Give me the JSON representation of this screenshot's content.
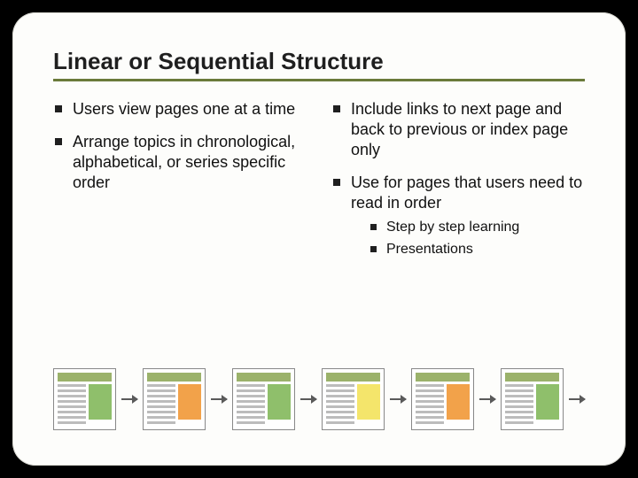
{
  "title": "Linear or Sequential Structure",
  "left": {
    "items": [
      "Users view pages one at a time",
      "Arrange topics in chronological, alphabetical, or series specific order"
    ]
  },
  "right": {
    "items": [
      "Include links to next page and back to previous or index page only",
      "Use for pages that users need to read in order"
    ],
    "sub": [
      "Step by step learning",
      "Presentations"
    ]
  },
  "pages": [
    "g",
    "o",
    "g",
    "y",
    "o",
    "g"
  ]
}
